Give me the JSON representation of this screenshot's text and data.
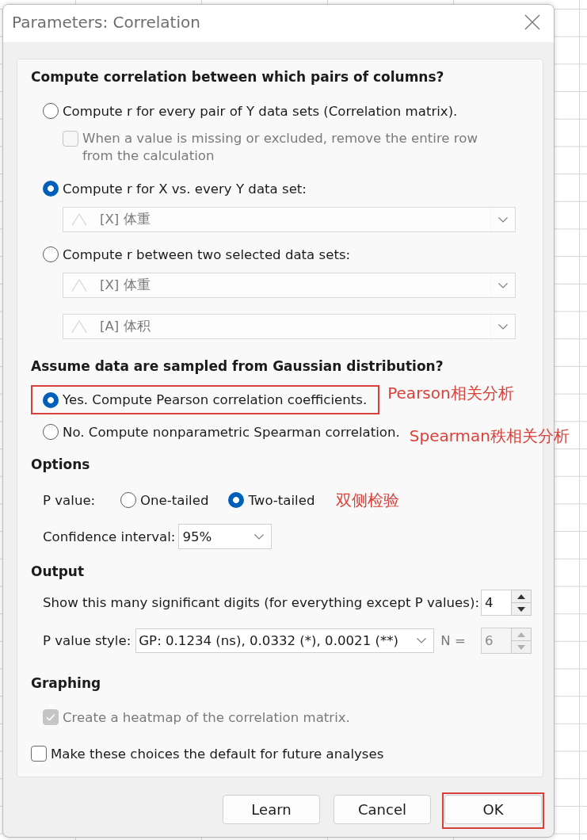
{
  "window": {
    "title": "Parameters: Correlation"
  },
  "pairs": {
    "heading": "Compute correlation between which pairs of columns?",
    "options": [
      {
        "label": "Compute r for every pair of Y data sets (Correlation matrix).",
        "selected": false,
        "checkbox": {
          "label": "When a value is missing or excluded, remove the entire row from the calculation",
          "checked": false,
          "disabled": true
        }
      },
      {
        "label": "Compute r for X vs. every Y data set:",
        "selected": true,
        "dropdowns": [
          {
            "value": "[X] 体重",
            "disabled": true
          }
        ]
      },
      {
        "label": "Compute r between two selected data sets:",
        "selected": false,
        "dropdowns": [
          {
            "value": "[X] 体重",
            "disabled": true
          },
          {
            "value": "[A] 体积",
            "disabled": true
          }
        ]
      }
    ]
  },
  "gaussian": {
    "heading": "Assume data are sampled from Gaussian distribution?",
    "options": [
      {
        "label": "Yes. Compute Pearson correlation coefficients.",
        "selected": true,
        "highlighted": true,
        "annotation": "Pearson相关分析"
      },
      {
        "label": "No. Compute nonparametric Spearman correlation.",
        "selected": false,
        "annotation": "Spearman秩相关分析"
      }
    ]
  },
  "options": {
    "heading": "Options",
    "p_value": {
      "label": "P value:",
      "choices": [
        {
          "label": "One-tailed",
          "selected": false
        },
        {
          "label": "Two-tailed",
          "selected": true
        }
      ],
      "annotation": "双侧检验"
    },
    "confidence_interval": {
      "label": "Confidence interval:",
      "value": "95%",
      "disabled": false
    }
  },
  "output": {
    "heading": "Output",
    "digits": {
      "label": "Show this many significant digits (for everything except P values):",
      "value": "4",
      "disabled": false
    },
    "p_value_style": {
      "label": "P value style:",
      "value": "GP: 0.1234 (ns), 0.0332 (*), 0.0021 (**)",
      "disabled": false
    },
    "n": {
      "label": "N =",
      "value": "6",
      "disabled": true
    }
  },
  "graphing": {
    "heading": "Graphing",
    "checkbox": {
      "label": "Create a heatmap of the correlation matrix.",
      "checked": true,
      "disabled": true
    }
  },
  "default_checkbox": {
    "label": "Make these choices the default for future analyses",
    "checked": false,
    "disabled": false
  },
  "buttons": [
    {
      "label": "Learn"
    },
    {
      "label": "Cancel"
    },
    {
      "label": "OK",
      "highlighted": true
    }
  ]
}
